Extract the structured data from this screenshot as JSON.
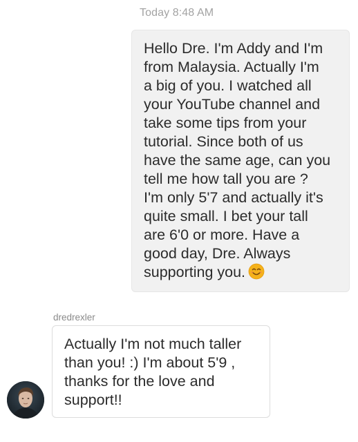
{
  "conversation": {
    "timestamp": "Today 8:48 AM",
    "outgoing_message": {
      "text": "Hello Dre. I'm Addy and I'm\nfrom Malaysia. Actually I'm\na big of you. I watched all\nyour YouTube channel and\ntake some tips from your\ntutorial. Since both of us\nhave the same age, can you\ntell me how tall you are ?\nI'm only 5'7 and actually it's\nquite small. I bet your tall\nare 6'0 or more. Have a\ngood day, Dre. Always\nsupporting you.",
      "emoji": "smiling-face-emoji"
    },
    "incoming_message": {
      "sender": "dredrexler",
      "text": "Actually I'm not much taller\nthan you! :) I'm about 5'9 ,\nthanks for the love and\nsupport!!"
    }
  },
  "colors": {
    "outgoing_bubble": "#f1f1f1",
    "incoming_bubble_border": "#dcdcdc",
    "timestamp": "#a3a3a3",
    "message_text": "#2b2b2b"
  }
}
